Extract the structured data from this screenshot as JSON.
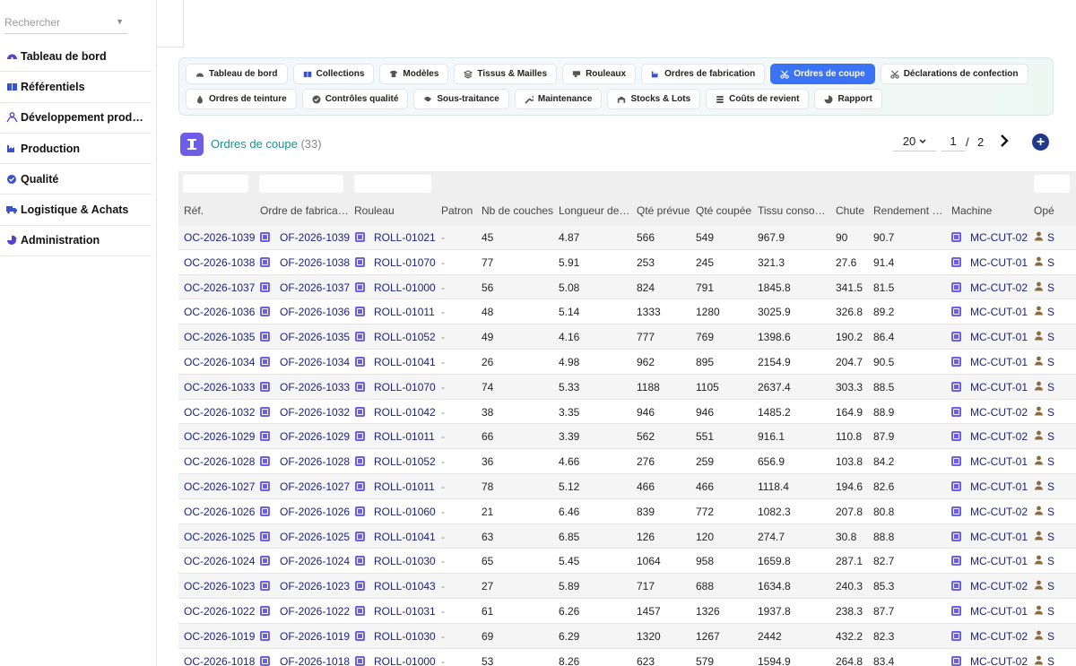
{
  "sidebar": {
    "search_placeholder": "Rechercher",
    "items": [
      {
        "label": "Tableau de bord",
        "icon": "dashboard-icon"
      },
      {
        "label": "Référentiels",
        "icon": "book-icon"
      },
      {
        "label": "Développement prod…",
        "icon": "people-icon"
      },
      {
        "label": "Production",
        "icon": "factory-icon"
      },
      {
        "label": "Qualité",
        "icon": "check-badge-icon"
      },
      {
        "label": "Logistique & Achats",
        "icon": "truck-icon"
      },
      {
        "label": "Administration",
        "icon": "pie-icon"
      }
    ]
  },
  "tabs": {
    "row1": [
      {
        "label": "Tableau de bord",
        "icon": "gauge-icon"
      },
      {
        "label": "Collections",
        "icon": "book-icon"
      },
      {
        "label": "Modèles",
        "icon": "shirt-icon"
      },
      {
        "label": "Tissus & Mailles",
        "icon": "layers-icon"
      },
      {
        "label": "Rouleaux",
        "icon": "roll-icon"
      },
      {
        "label": "Ordres de fabrication",
        "icon": "factory-icon"
      },
      {
        "label": "Ordres de coupe",
        "icon": "scissors-icon",
        "active": true
      },
      {
        "label": "Déclarations de confection",
        "icon": "scissors-icon"
      }
    ],
    "row2": [
      {
        "label": "Ordres de teinture",
        "icon": "droplet-icon"
      },
      {
        "label": "Contrôles qualité",
        "icon": "check-circle-icon"
      },
      {
        "label": "Sous-traitance",
        "icon": "handshake-icon"
      },
      {
        "label": "Maintenance",
        "icon": "wrench-icon"
      },
      {
        "label": "Stocks & Lots",
        "icon": "warehouse-icon"
      },
      {
        "label": "Coûts de revient",
        "icon": "coins-icon"
      },
      {
        "label": "Rapport",
        "icon": "chart-pie-icon"
      }
    ]
  },
  "list": {
    "title": "Ordres de coupe",
    "count": "(33)",
    "page_size": "20",
    "page": "1",
    "page_sep": "/",
    "page_total": "2"
  },
  "columns": [
    "Réf.",
    "Ordre de fabrica…",
    "Rouleau",
    "Patron",
    "Nb de couches",
    "Longueur de…",
    "Qté prévue",
    "Qté coupée",
    "Tissu conso…",
    "Chute",
    "Rendement …",
    "Machine",
    "Opé"
  ],
  "rows": [
    {
      "ref": "OC-2026-1039",
      "of": "OF-2026-1039",
      "roll": "ROLL-01021",
      "patron": "-",
      "couches": "45",
      "longueur": "4.87",
      "prevue": "566",
      "coupee": "549",
      "tissu": "967.9",
      "chute": "90",
      "rendement": "90.7",
      "machine": "MC-CUT-02",
      "op": "S"
    },
    {
      "ref": "OC-2026-1038",
      "of": "OF-2026-1038",
      "roll": "ROLL-01070",
      "patron": "-",
      "couches": "77",
      "longueur": "5.91",
      "prevue": "253",
      "coupee": "245",
      "tissu": "321.3",
      "chute": "27.6",
      "rendement": "91.4",
      "machine": "MC-CUT-01",
      "op": "S"
    },
    {
      "ref": "OC-2026-1037",
      "of": "OF-2026-1037",
      "roll": "ROLL-01000",
      "patron": "-",
      "couches": "56",
      "longueur": "5.08",
      "prevue": "824",
      "coupee": "791",
      "tissu": "1845.8",
      "chute": "341.5",
      "rendement": "81.5",
      "machine": "MC-CUT-02",
      "op": "S"
    },
    {
      "ref": "OC-2026-1036",
      "of": "OF-2026-1036",
      "roll": "ROLL-01011",
      "patron": "-",
      "couches": "48",
      "longueur": "5.14",
      "prevue": "1333",
      "coupee": "1280",
      "tissu": "3025.9",
      "chute": "326.8",
      "rendement": "89.2",
      "machine": "MC-CUT-01",
      "op": "S"
    },
    {
      "ref": "OC-2026-1035",
      "of": "OF-2026-1035",
      "roll": "ROLL-01052",
      "patron": "-",
      "couches": "49",
      "longueur": "4.16",
      "prevue": "777",
      "coupee": "769",
      "tissu": "1398.6",
      "chute": "190.2",
      "rendement": "86.4",
      "machine": "MC-CUT-01",
      "op": "S"
    },
    {
      "ref": "OC-2026-1034",
      "of": "OF-2026-1034",
      "roll": "ROLL-01041",
      "patron": "-",
      "couches": "26",
      "longueur": "4.98",
      "prevue": "962",
      "coupee": "895",
      "tissu": "2154.9",
      "chute": "204.7",
      "rendement": "90.5",
      "machine": "MC-CUT-01",
      "op": "S"
    },
    {
      "ref": "OC-2026-1033",
      "of": "OF-2026-1033",
      "roll": "ROLL-01070",
      "patron": "-",
      "couches": "74",
      "longueur": "5.33",
      "prevue": "1188",
      "coupee": "1105",
      "tissu": "2637.4",
      "chute": "303.3",
      "rendement": "88.5",
      "machine": "MC-CUT-01",
      "op": "S"
    },
    {
      "ref": "OC-2026-1032",
      "of": "OF-2026-1032",
      "roll": "ROLL-01042",
      "patron": "-",
      "couches": "38",
      "longueur": "3.35",
      "prevue": "946",
      "coupee": "946",
      "tissu": "1485.2",
      "chute": "164.9",
      "rendement": "88.9",
      "machine": "MC-CUT-02",
      "op": "S"
    },
    {
      "ref": "OC-2026-1029",
      "of": "OF-2026-1029",
      "roll": "ROLL-01011",
      "patron": "-",
      "couches": "66",
      "longueur": "3.39",
      "prevue": "562",
      "coupee": "551",
      "tissu": "916.1",
      "chute": "110.8",
      "rendement": "87.9",
      "machine": "MC-CUT-02",
      "op": "S"
    },
    {
      "ref": "OC-2026-1028",
      "of": "OF-2026-1028",
      "roll": "ROLL-01052",
      "patron": "-",
      "couches": "36",
      "longueur": "4.66",
      "prevue": "276",
      "coupee": "259",
      "tissu": "656.9",
      "chute": "103.8",
      "rendement": "84.2",
      "machine": "MC-CUT-01",
      "op": "S"
    },
    {
      "ref": "OC-2026-1027",
      "of": "OF-2026-1027",
      "roll": "ROLL-01011",
      "patron": "-",
      "couches": "78",
      "longueur": "5.12",
      "prevue": "466",
      "coupee": "466",
      "tissu": "1118.4",
      "chute": "194.6",
      "rendement": "82.6",
      "machine": "MC-CUT-01",
      "op": "S"
    },
    {
      "ref": "OC-2026-1026",
      "of": "OF-2026-1026",
      "roll": "ROLL-01060",
      "patron": "-",
      "couches": "21",
      "longueur": "6.46",
      "prevue": "839",
      "coupee": "772",
      "tissu": "1082.3",
      "chute": "207.8",
      "rendement": "80.8",
      "machine": "MC-CUT-02",
      "op": "S"
    },
    {
      "ref": "OC-2026-1025",
      "of": "OF-2026-1025",
      "roll": "ROLL-01041",
      "patron": "-",
      "couches": "63",
      "longueur": "6.85",
      "prevue": "126",
      "coupee": "120",
      "tissu": "274.7",
      "chute": "30.8",
      "rendement": "88.8",
      "machine": "MC-CUT-01",
      "op": "S"
    },
    {
      "ref": "OC-2026-1024",
      "of": "OF-2026-1024",
      "roll": "ROLL-01030",
      "patron": "-",
      "couches": "65",
      "longueur": "5.45",
      "prevue": "1064",
      "coupee": "958",
      "tissu": "1659.8",
      "chute": "287.1",
      "rendement": "82.7",
      "machine": "MC-CUT-01",
      "op": "S"
    },
    {
      "ref": "OC-2026-1023",
      "of": "OF-2026-1023",
      "roll": "ROLL-01043",
      "patron": "-",
      "couches": "27",
      "longueur": "5.89",
      "prevue": "717",
      "coupee": "688",
      "tissu": "1634.8",
      "chute": "240.3",
      "rendement": "85.3",
      "machine": "MC-CUT-02",
      "op": "S"
    },
    {
      "ref": "OC-2026-1022",
      "of": "OF-2026-1022",
      "roll": "ROLL-01031",
      "patron": "-",
      "couches": "61",
      "longueur": "6.26",
      "prevue": "1457",
      "coupee": "1326",
      "tissu": "1937.8",
      "chute": "238.3",
      "rendement": "87.7",
      "machine": "MC-CUT-01",
      "op": "S"
    },
    {
      "ref": "OC-2026-1019",
      "of": "OF-2026-1019",
      "roll": "ROLL-01030",
      "patron": "-",
      "couches": "69",
      "longueur": "6.29",
      "prevue": "1320",
      "coupee": "1267",
      "tissu": "2442",
      "chute": "432.2",
      "rendement": "82.3",
      "machine": "MC-CUT-02",
      "op": "S"
    },
    {
      "ref": "OC-2026-1018",
      "of": "OF-2026-1018",
      "roll": "ROLL-01000",
      "patron": "-",
      "couches": "53",
      "longueur": "8.26",
      "prevue": "623",
      "coupee": "579",
      "tissu": "1594.9",
      "chute": "264.8",
      "rendement": "83.4",
      "machine": "MC-CUT-02",
      "op": "S"
    }
  ],
  "colors": {
    "accent": "#3b73f6",
    "link": "#1a237e",
    "title": "#1e8e8e",
    "ref_icon": "#6d5ee8",
    "add_button": "#1f3a8a"
  }
}
